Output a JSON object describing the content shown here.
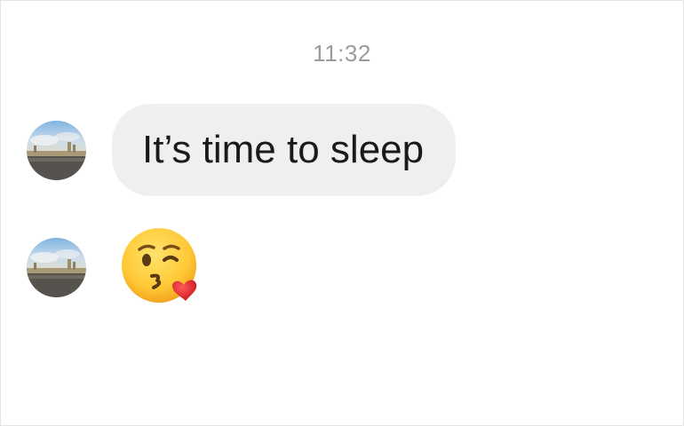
{
  "chat": {
    "timestamp": "11:32",
    "messages": [
      {
        "type": "text",
        "text": "It’s time to sleep"
      },
      {
        "type": "emoji",
        "emoji_name": "face-blowing-a-kiss-icon"
      }
    ]
  },
  "colors": {
    "bubble_background": "#efefef",
    "timestamp_text": "#9b9b9b",
    "message_text": "#1a1a1a"
  }
}
